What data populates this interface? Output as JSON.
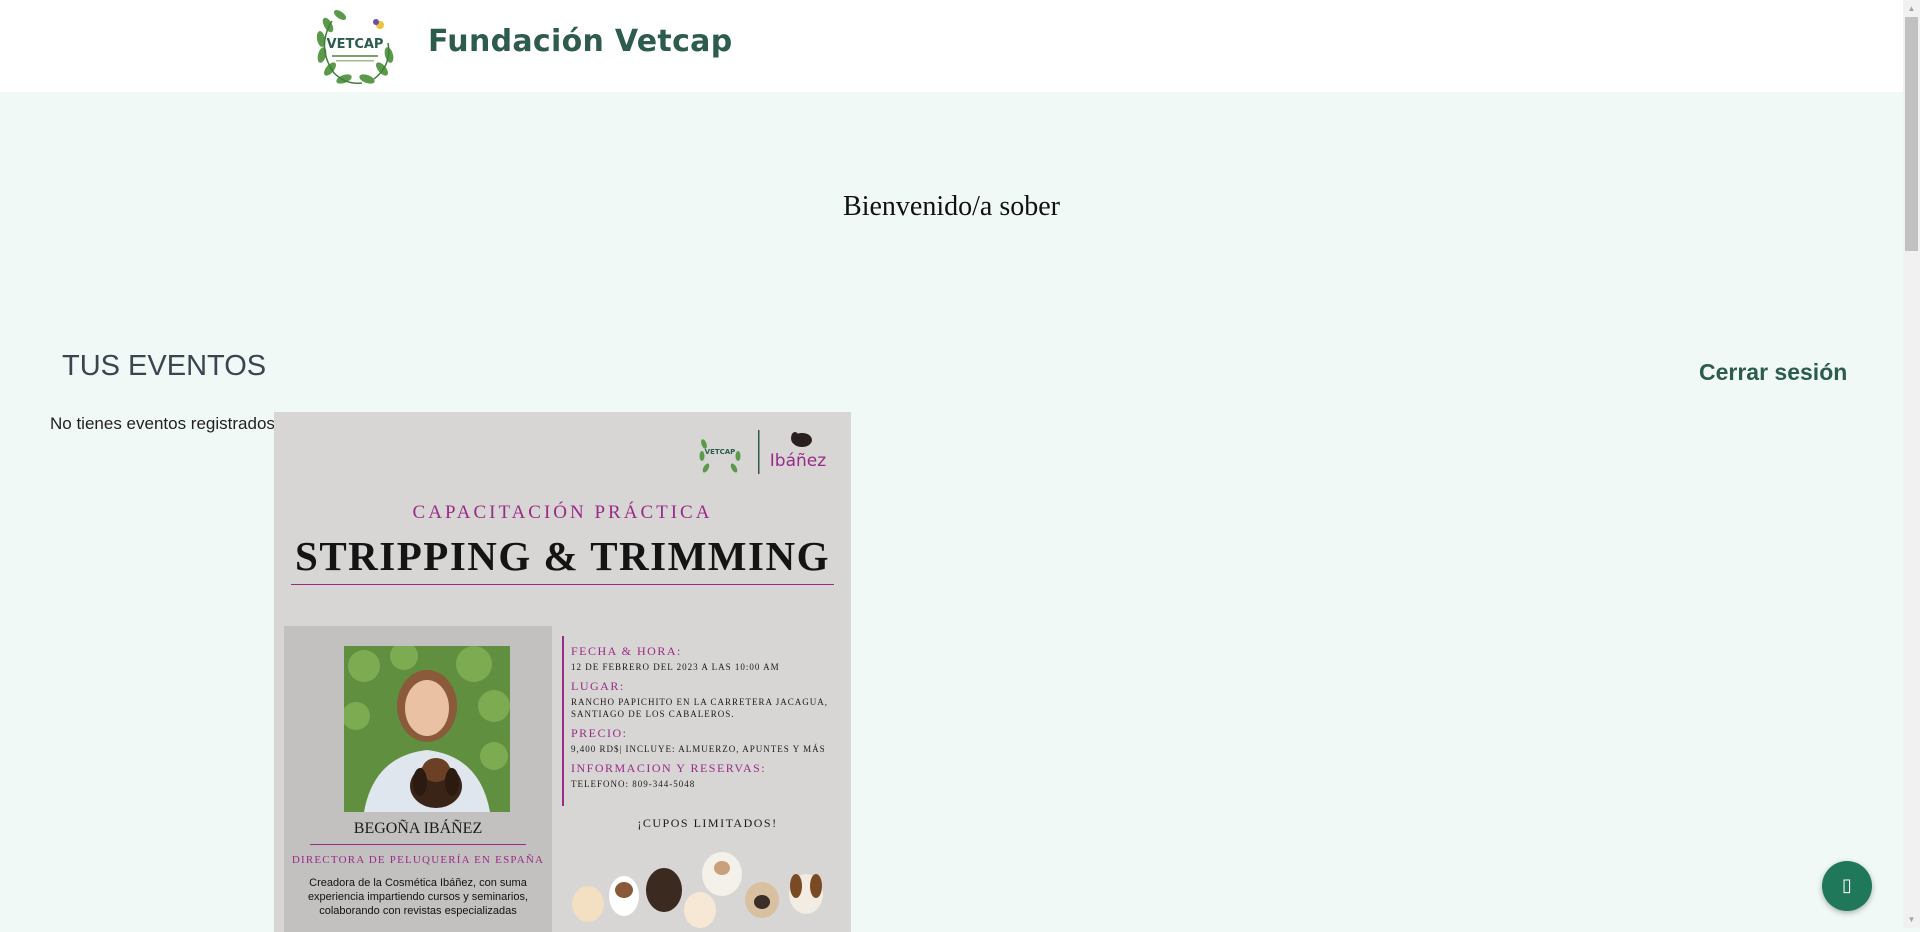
{
  "header": {
    "logo_icon": "vetcap-laurel-logo",
    "logo_text": "VETCAP",
    "brand_name": "Fundación Vetcap"
  },
  "main": {
    "welcome": "Bienvenido/a sober",
    "events_title": "TUS EVENTOS",
    "logout_label": "Cerrar sesión",
    "no_events": "No tienes eventos registrados"
  },
  "poster": {
    "partner_logo_text": "Ibáñez",
    "subtitle": "CAPACITACIÓN PRÁCTICA",
    "title": "STRIPPING & TRIMMING",
    "speaker_name": "BEGOÑA IBÁÑEZ",
    "speaker_role": "DIRECTORA DE PELUQUERÍA EN ESPAÑA",
    "speaker_bio": "Creadora de la Cosmética Ibáñez, con suma experiencia impartiendo cursos y seminarios, colaborando con revistas especializadas",
    "fecha_label": "FECHA & HORA:",
    "fecha_value": "12 DE FEBRERO DEL 2023 A LAS 10:00 AM",
    "lugar_label": "LUGAR:",
    "lugar_value": "RANCHO PAPICHITO EN LA CARRETERA JACAGUA, SANTIAGO DE LOS CABALEROS.",
    "precio_label": "PRECIO:",
    "precio_value": "9,400 RD$| INCLUYE: ALMUERZO, APUNTES Y MÁS",
    "info_label": "INFORMACION Y RESERVAS:",
    "info_value": "TELEFONO: 809-344-5048",
    "cupos": "¡CUPOS LIMITADOS!"
  },
  "fab": {
    "icon": "chat-icon",
    "glyph": "▯"
  },
  "scrollbar": {
    "up": "▲",
    "down": "▼"
  },
  "colors": {
    "brand": "#2d5b4e",
    "page_bg": "#f1f9f7",
    "poster_accent": "#9a2a88",
    "fab": "#20785a"
  }
}
